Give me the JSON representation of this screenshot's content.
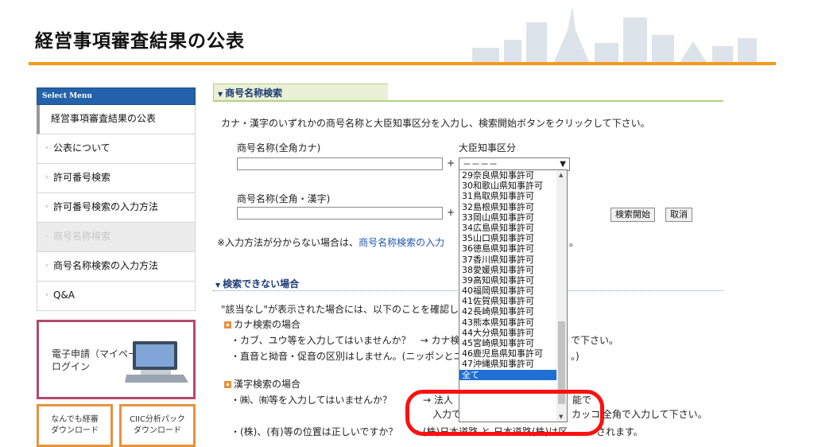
{
  "header": {
    "title": "経営事項審査結果の公表"
  },
  "sidebar": {
    "heading": "Select Menu",
    "items": [
      {
        "label": "経営事項審査結果の公表"
      },
      {
        "label": "公表について"
      },
      {
        "label": "許可番号検索"
      },
      {
        "label": "許可番号検索の入力方法"
      },
      {
        "label": "商号名称検索"
      },
      {
        "label": "商号名称検索の入力方法"
      },
      {
        "label": "Q&A"
      }
    ],
    "banner_main": {
      "line1": "電子申請（マイページ）",
      "line2": "ログイン"
    },
    "banner_left": {
      "line1": "なんでも経審",
      "line2": "ダウンロード"
    },
    "banner_right": {
      "line1": "CIIC分析パック",
      "line2": "ダウンロード"
    }
  },
  "main": {
    "section_title": "商号名称検索",
    "intro": "カナ・漢字のいずれかの商号名称と大臣知事区分を入力し、検索開始ボタンをクリックして下さい。",
    "kana_label": "商号名称(全角カナ)",
    "kanji_label": "商号名称(全角・漢字)",
    "plus": "+",
    "category_label": "大臣知事区分",
    "category_value": "－－－－",
    "search_button": "検索開始",
    "cancel_button": "取消",
    "note_prefix": "※入力方法が分からない場合は、",
    "note_link": "商号名称検索の入力",
    "note_suffix": "。",
    "sub_title": "検索できない場合",
    "cannot_intro": "\"該当なし\"が表示された場合には、以下のことを確認し",
    "kana_head": "カナ検索の場合",
    "kana_line1a": "・カブ、ユウ等を入力してはいませんか？　→ カナ検",
    "kana_line1b": "で下さい。",
    "kana_line2a": "・直音と拗音・促音の区別はしません。(ニッポンとニ",
    "kana_line2b": "。)",
    "kanji_head": "漢字検索の場合",
    "kanji_line1a": "・㈱、㈲等を入力してはいませんか？",
    "kanji_line1b": "→ 法人",
    "kanji_line1c": "能で",
    "kanji_line2a": "入力で",
    "kanji_line2b": "カッコ",
    "kanji_line2c": "全角で入力して下さい。",
    "kanji_line3a": "・(株)、(有)等の位置は正しいですか？",
    "kanji_line3b": "→ (株)日本道路 と 日本道路(株)は区",
    "kanji_line3c": "されます。"
  },
  "dropdown": {
    "options": [
      "29奈良県知事許可",
      "30和歌山県知事許可",
      "31鳥取県知事許可",
      "32島根県知事許可",
      "33岡山県知事許可",
      "34広島県知事許可",
      "35山口県知事許可",
      "36徳島県知事許可",
      "37香川県知事許可",
      "38愛媛県知事許可",
      "39高知県知事許可",
      "40福岡県知事許可",
      "41佐賀県知事許可",
      "42長崎県知事許可",
      "43熊本県知事許可",
      "44大分県知事許可",
      "45宮崎県知事許可",
      "46鹿児島県知事許可",
      "47沖縄県知事許可",
      "全て"
    ],
    "selected": "全て"
  },
  "colors": {
    "accent": "#f39a1a",
    "nav": "#2262a8",
    "highlight": "#ff1010",
    "selection": "#1e70d4"
  }
}
